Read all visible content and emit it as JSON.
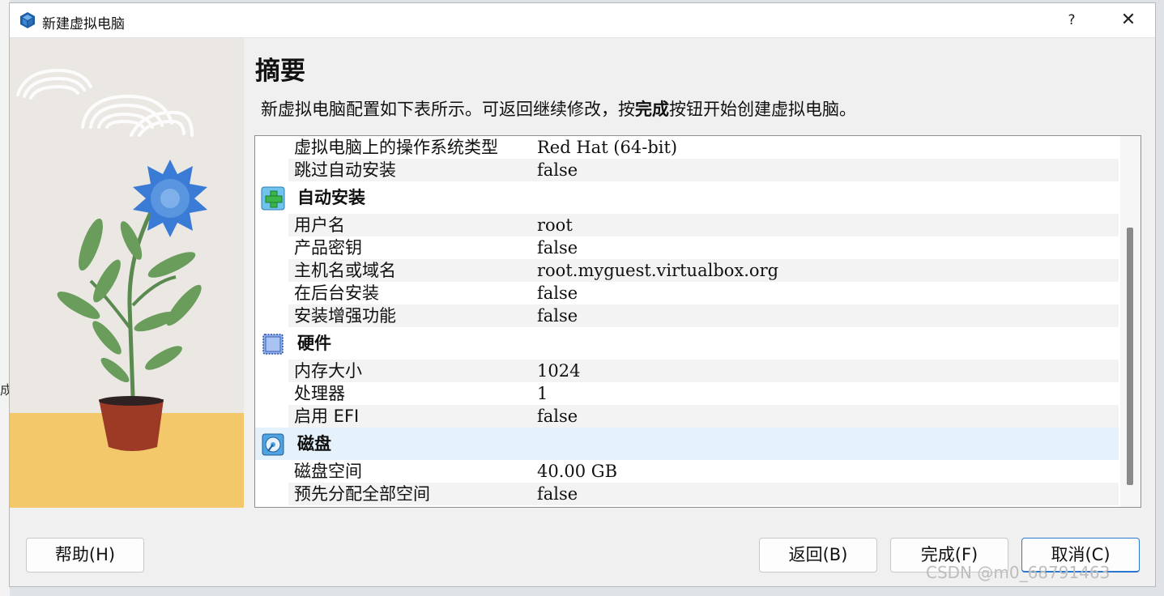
{
  "window": {
    "title": "新建虚拟电脑",
    "help_label": "?",
    "close_label": "✕"
  },
  "background": {
    "cut_text": "成"
  },
  "page": {
    "heading": "摘要",
    "description_before": "新虚拟电脑配置如下表所示。可返回继续修改，按",
    "description_bold": "完成",
    "description_after": "按钮开始创建虚拟电脑。"
  },
  "summary": {
    "top_rows": [
      {
        "key": "虚拟电脑上的操作系统类型",
        "value": "Red Hat (64-bit)"
      },
      {
        "key": "跳过自动安装",
        "value": "false"
      }
    ],
    "sections": [
      {
        "title": "自动安装",
        "icon": "unattended-install-icon",
        "rows": [
          {
            "key": "用户名",
            "value": "root"
          },
          {
            "key": "产品密钥",
            "value": "false"
          },
          {
            "key": "主机名或域名",
            "value": "root.myguest.virtualbox.org"
          },
          {
            "key": "在后台安装",
            "value": "false"
          },
          {
            "key": "安装增强功能",
            "value": "false"
          }
        ]
      },
      {
        "title": "硬件",
        "icon": "hardware-chip-icon",
        "rows": [
          {
            "key": "内存大小",
            "value": "1024"
          },
          {
            "key": "处理器",
            "value": "1"
          },
          {
            "key": "启用 EFI",
            "value": "false"
          }
        ]
      },
      {
        "title": "磁盘",
        "icon": "hard-disk-icon",
        "rows": [
          {
            "key": "磁盘空间",
            "value": "40.00 GB"
          },
          {
            "key": "预先分配全部空间",
            "value": "false"
          }
        ]
      }
    ]
  },
  "buttons": {
    "help": "帮助(H)",
    "back": "返回(B)",
    "finish": "完成(F)",
    "cancel": "取消(C)"
  },
  "watermark": "CSDN @m0_68791463",
  "colors": {
    "selected_section": "#e5f1fb",
    "primary_border": "#2b78d0"
  }
}
